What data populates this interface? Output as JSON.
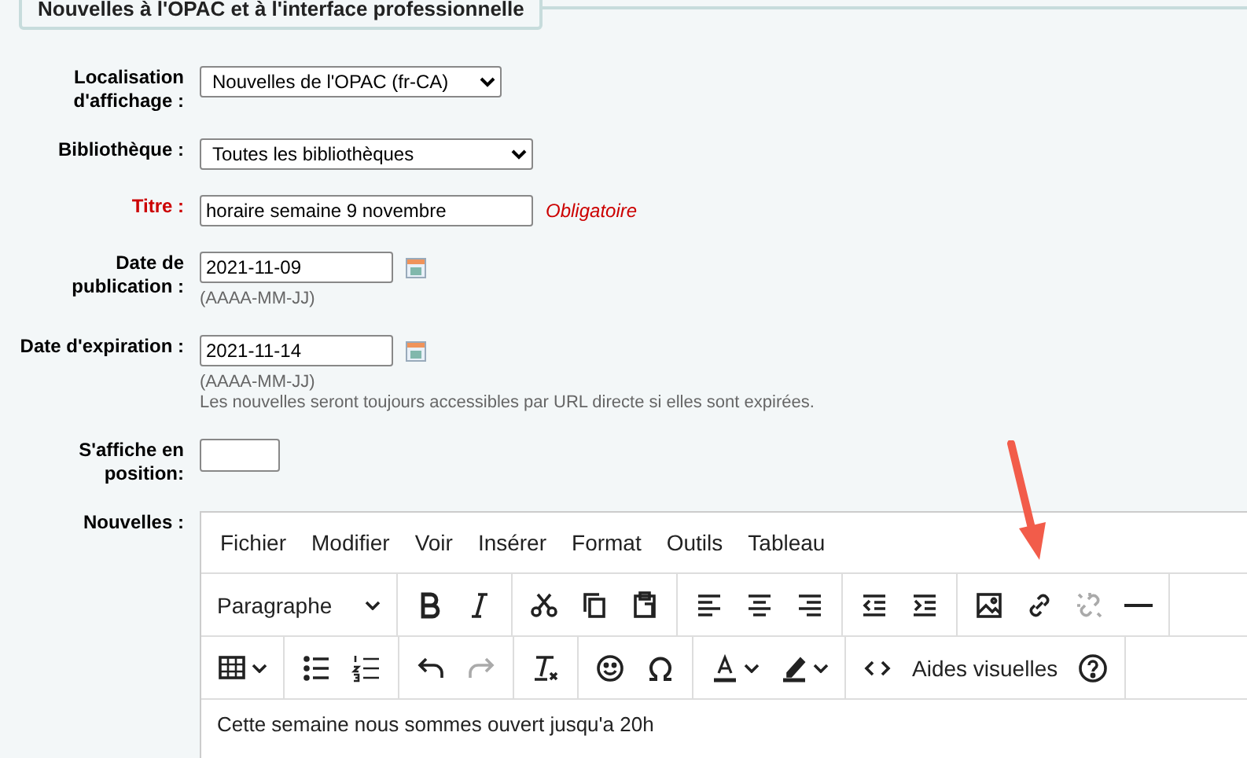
{
  "legend": "Nouvelles à l'OPAC et à l'interface professionnelle",
  "fields": [
    {
      "kind": "select",
      "label": "Localisation\nd'affichage :",
      "value": "Nouvelles de l'OPAC (fr-CA)",
      "required": false
    },
    {
      "kind": "select",
      "label": "Bibliothèque :",
      "value": "Toutes les bibliothèques",
      "required": false
    },
    {
      "kind": "text",
      "label": "Titre :",
      "value": "horaire semaine 9 novembre",
      "required": true,
      "required_note": "Obligatoire"
    },
    {
      "kind": "date",
      "label": "Date de\npublication :",
      "value": "2021-11-09",
      "required": false,
      "hints": [
        "(AAAA-MM-JJ)"
      ]
    },
    {
      "kind": "date",
      "label": "Date d'expiration :",
      "value": "2021-11-14",
      "required": false,
      "hints": [
        "(AAAA-MM-JJ)",
        "Les nouvelles seront toujours accessibles par URL directe si elles sont expirées."
      ]
    },
    {
      "kind": "text",
      "label": "S'affiche en\nposition:",
      "required": false
    }
  ],
  "editor": {
    "label": "Nouvelles :",
    "menu": [
      "Fichier",
      "Modifier",
      "Voir",
      "Insérer",
      "Format",
      "Outils",
      "Tableau"
    ],
    "toolbar_rows": [
      [
        [
          {
            "kind": "blockformat",
            "text": "Paragraphe",
            "disabled": false
          }
        ],
        [
          {
            "kind": "bold",
            "disabled": false
          },
          {
            "kind": "italic",
            "disabled": false
          }
        ],
        [
          {
            "kind": "cut",
            "disabled": false
          },
          {
            "kind": "copy",
            "disabled": false
          },
          {
            "kind": "paste",
            "disabled": false
          }
        ],
        [
          {
            "kind": "alignleft",
            "disabled": false
          },
          {
            "kind": "aligncenter",
            "disabled": false
          },
          {
            "kind": "alignright",
            "disabled": false
          }
        ],
        [
          {
            "kind": "outdent",
            "disabled": false
          },
          {
            "kind": "indent",
            "disabled": false
          }
        ],
        [
          {
            "kind": "image",
            "disabled": false
          },
          {
            "kind": "link",
            "disabled": false
          },
          {
            "kind": "unlink",
            "disabled": true
          },
          {
            "kind": "hr",
            "disabled": false
          }
        ]
      ],
      [
        [
          {
            "kind": "table",
            "disabled": false
          }
        ],
        [
          {
            "kind": "bullist",
            "disabled": false
          },
          {
            "kind": "numlist",
            "disabled": false
          }
        ],
        [
          {
            "kind": "undo",
            "disabled": false
          },
          {
            "kind": "redo",
            "disabled": true
          }
        ],
        [
          {
            "kind": "clearformat",
            "disabled": false
          }
        ],
        [
          {
            "kind": "emoji",
            "disabled": false
          },
          {
            "kind": "omega",
            "disabled": false
          }
        ],
        [
          {
            "kind": "forecolor",
            "disabled": false
          },
          {
            "kind": "highlight",
            "disabled": false
          }
        ],
        [
          {
            "kind": "code",
            "disabled": false
          },
          {
            "kind": "visualaid",
            "text": "Aides visuelles",
            "disabled": false
          },
          {
            "kind": "help",
            "disabled": false
          }
        ]
      ]
    ],
    "content": "Cette semaine nous sommes ouvert jusqu'a 20h"
  }
}
